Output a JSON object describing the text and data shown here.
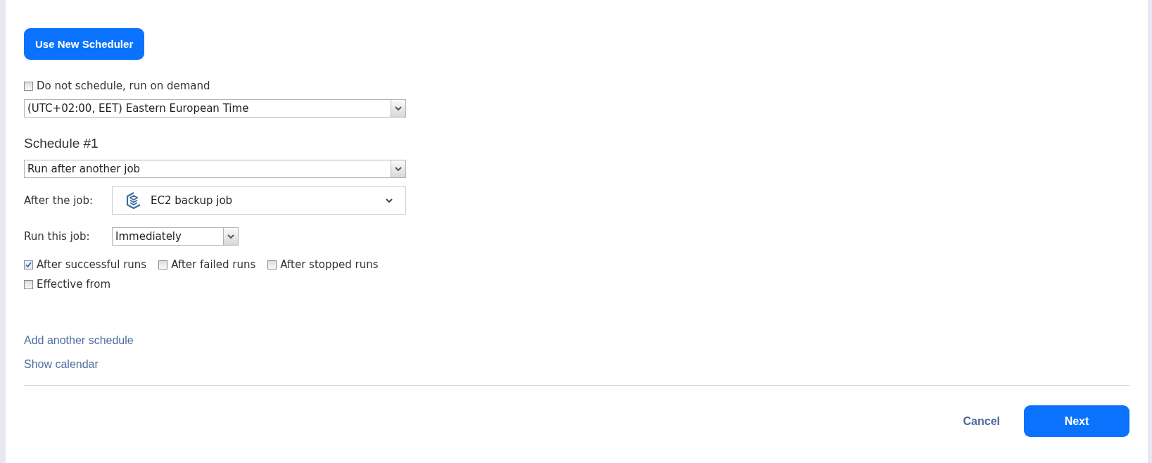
{
  "new_scheduler_button": "Use New Scheduler",
  "on_demand": {
    "label": "Do not schedule, run on demand",
    "checked": false
  },
  "timezone": {
    "value": "(UTC+02:00, EET) Eastern European Time"
  },
  "schedule": {
    "title": "Schedule #1",
    "type": {
      "value": "Run after another job"
    },
    "after_job": {
      "label": "After the job:",
      "value": "EC2 backup job"
    },
    "run_this_job": {
      "label": "Run this job:",
      "value": "Immediately"
    },
    "conditions": [
      {
        "label": "After successful runs",
        "checked": true
      },
      {
        "label": "After failed runs",
        "checked": false
      },
      {
        "label": "After stopped runs",
        "checked": false
      }
    ],
    "effective_from": {
      "label": "Effective from",
      "checked": false
    }
  },
  "links": [
    "Add another schedule",
    "Show calendar"
  ],
  "footer": {
    "cancel": "Cancel",
    "next": "Next"
  }
}
